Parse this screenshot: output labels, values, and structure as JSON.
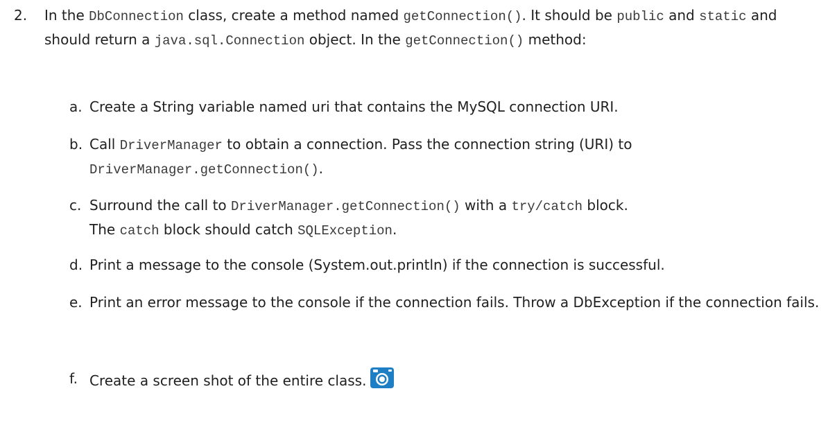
{
  "step": {
    "number": "2.",
    "p1": "In the ",
    "c1": "DbConnection",
    "p2": " class, create a method named ",
    "c2": "getConnection()",
    "p3": ". It should be ",
    "c3": "public",
    "p4": " and ",
    "c4": "static",
    "p5": " and should return a ",
    "c5": "java.sql.Connection",
    "p6": " object. In the ",
    "c6": "getConnection()",
    "p7": " method:"
  },
  "substeps": {
    "a": {
      "letter": "a.",
      "text": "Create a String variable named uri that contains the MySQL connection URI."
    },
    "b": {
      "letter": "b.",
      "p1": "Call ",
      "c1": "DriverManager",
      "p2": " to obtain a connection. Pass the connection string (URI) to ",
      "c2": "DriverManager.getConnection()",
      "p3": "."
    },
    "c": {
      "letter": "c.",
      "p1": "Surround the call to ",
      "c1": "DriverManager.getConnection()",
      "p2": " with a ",
      "c2": "try/catch",
      "p3": " block. The ",
      "c3": "catch",
      "p4": " block should catch ",
      "c4": "SQLException",
      "p5": "."
    },
    "d": {
      "letter": "d.",
      "text": "Print a message to the console (System.out.println) if the connection is successful."
    },
    "e": {
      "letter": "e.",
      "text": "Print an error message to the console if the connection fails. Throw a DbException if the connection fails."
    },
    "f": {
      "letter": "f.",
      "text": "Create a screen shot of the entire class.",
      "icon": "camera-icon",
      "icon_color": "#1f7fc4"
    }
  }
}
